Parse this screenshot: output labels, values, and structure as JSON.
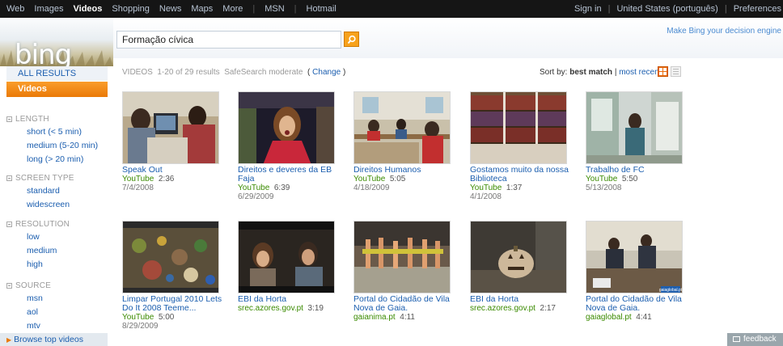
{
  "topnav": {
    "items": [
      {
        "label": "Web",
        "active": false
      },
      {
        "label": "Images",
        "active": false
      },
      {
        "label": "Videos",
        "active": true
      },
      {
        "label": "Shopping",
        "active": false
      },
      {
        "label": "News",
        "active": false
      },
      {
        "label": "Maps",
        "active": false
      },
      {
        "label": "More",
        "active": false
      }
    ],
    "msn": "MSN",
    "hotmail": "Hotmail",
    "sign_in": "Sign in",
    "region": "United States  (português)",
    "preferences": "Preferences"
  },
  "brand": {
    "logo": "bing",
    "tagline": "Make Bing your decision engine"
  },
  "search": {
    "query": "Formação cívica"
  },
  "sidebar": {
    "all_results": "ALL RESULTS",
    "videos": "Videos",
    "browse": "Browse top videos"
  },
  "facets": {
    "length": {
      "title": "LENGTH",
      "items": [
        "short (< 5 min)",
        "medium (5-20 min)",
        "long (> 20 min)"
      ]
    },
    "screen": {
      "title": "SCREEN TYPE",
      "items": [
        "standard",
        "widescreen"
      ]
    },
    "resolution": {
      "title": "RESOLUTION",
      "items": [
        "low",
        "medium",
        "high"
      ]
    },
    "source": {
      "title": "SOURCE",
      "items": [
        "msn",
        "aol",
        "mtv"
      ]
    }
  },
  "results_header": {
    "label": "VIDEOS",
    "count": "1-20 of 29 results",
    "safesearch": "SafeSearch moderate",
    "change": "Change",
    "sort_label": "Sort by:",
    "sort_current": "best match",
    "sort_sep": "|",
    "sort_other": "most recent"
  },
  "videos": [
    {
      "title": "Speak Out",
      "source": "YouTube",
      "duration": "2:36",
      "date": "7/4/2008",
      "icon": "thumbnail-classroom-computer"
    },
    {
      "title": "Direitos e deveres da EB Faja",
      "source": "YouTube",
      "duration": "6:39",
      "date": "6/29/2009",
      "icon": "thumbnail-girl-singing"
    },
    {
      "title": "Direitos Humanos",
      "source": "YouTube",
      "duration": "5:05",
      "date": "4/18/2009",
      "icon": "thumbnail-classroom"
    },
    {
      "title": "Gostamos muito da nossa Biblioteca",
      "source": "YouTube",
      "duration": "1:37",
      "date": "4/1/2008",
      "icon": "thumbnail-library"
    },
    {
      "title": "Trabalho de FC",
      "source": "YouTube",
      "duration": "5:50",
      "date": "5/13/2008",
      "icon": "thumbnail-school-corridor"
    },
    {
      "title": "Limpar Portugal 2010 Lets Do It 2008 Teeme...",
      "source": "YouTube",
      "duration": "5:00",
      "date": "8/29/2009",
      "icon": "thumbnail-litter"
    },
    {
      "title": "EBI da Horta",
      "source": "srec.azores.gov.pt",
      "duration": "3:19",
      "date": "",
      "icon": "thumbnail-students"
    },
    {
      "title": "Portal do Cidadão de Vila Nova de Gaia.",
      "source": "gaianima.pt",
      "duration": "4:11",
      "date": "",
      "icon": "thumbnail-dancers"
    },
    {
      "title": "EBI da Horta",
      "source": "srec.azores.gov.pt",
      "duration": "2:17",
      "date": "",
      "icon": "thumbnail-pumpkin"
    },
    {
      "title": "Portal do Cidadão de Vila Nova de Gaia.",
      "source": "gaiaglobal.pt",
      "duration": "4:41",
      "date": "",
      "icon": "thumbnail-meeting"
    }
  ],
  "thumb_watermark": "gaiaglobal.pt",
  "feedback": "feedback"
}
